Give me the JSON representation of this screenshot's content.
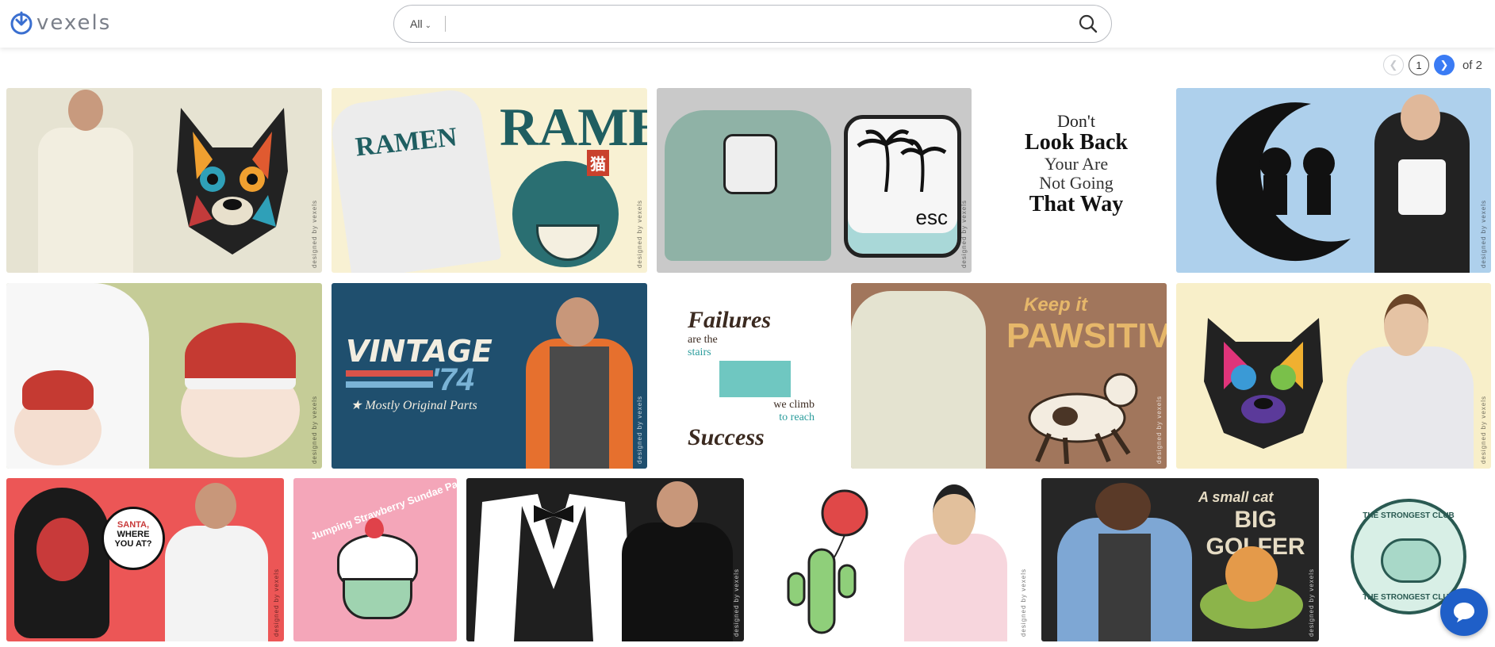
{
  "brand": {
    "name": "vexels",
    "color": "#3a6fd0"
  },
  "search": {
    "category": "All",
    "placeholder": "",
    "value": ""
  },
  "pagination": {
    "current": "1",
    "total_label": "of 2",
    "accent": "#3a7bf4"
  },
  "watermark": "designed by vexels",
  "designs": [
    {
      "id": "frenchie",
      "text": ""
    },
    {
      "id": "ramen",
      "text": "RAMEN",
      "tag": "猫"
    },
    {
      "id": "esc",
      "text": "esc"
    },
    {
      "id": "dont-look-back",
      "lines": [
        "Don't",
        "Look Back",
        "Your Are",
        "Not Going",
        "That Way"
      ]
    },
    {
      "id": "moon-kids",
      "text": ""
    },
    {
      "id": "bunny",
      "text": ""
    },
    {
      "id": "vintage",
      "text": "VINTAGE",
      "year": "'74",
      "sub": "★ Mostly Original Parts"
    },
    {
      "id": "failures",
      "lines": [
        "Failures",
        "are the",
        "stairs",
        "we climb",
        "to reach",
        "Success"
      ]
    },
    {
      "id": "pawsitive",
      "line1": "Keep it",
      "line2": "PAWSITIVE"
    },
    {
      "id": "pug",
      "text": ""
    },
    {
      "id": "santa",
      "lines": [
        "SANTA,",
        "WHERE",
        "YOU AT?"
      ]
    },
    {
      "id": "sundae",
      "text": "Jumping Strawberry Sundae Party"
    },
    {
      "id": "tuxedo",
      "text": ""
    },
    {
      "id": "cactus",
      "text": ""
    },
    {
      "id": "golfer",
      "line1": "A small cat",
      "line2": "BIG GOLFER"
    },
    {
      "id": "strongest",
      "text": "THE STRONGEST CLUB"
    }
  ],
  "chat": {
    "icon": "chat-bubble-icon"
  }
}
